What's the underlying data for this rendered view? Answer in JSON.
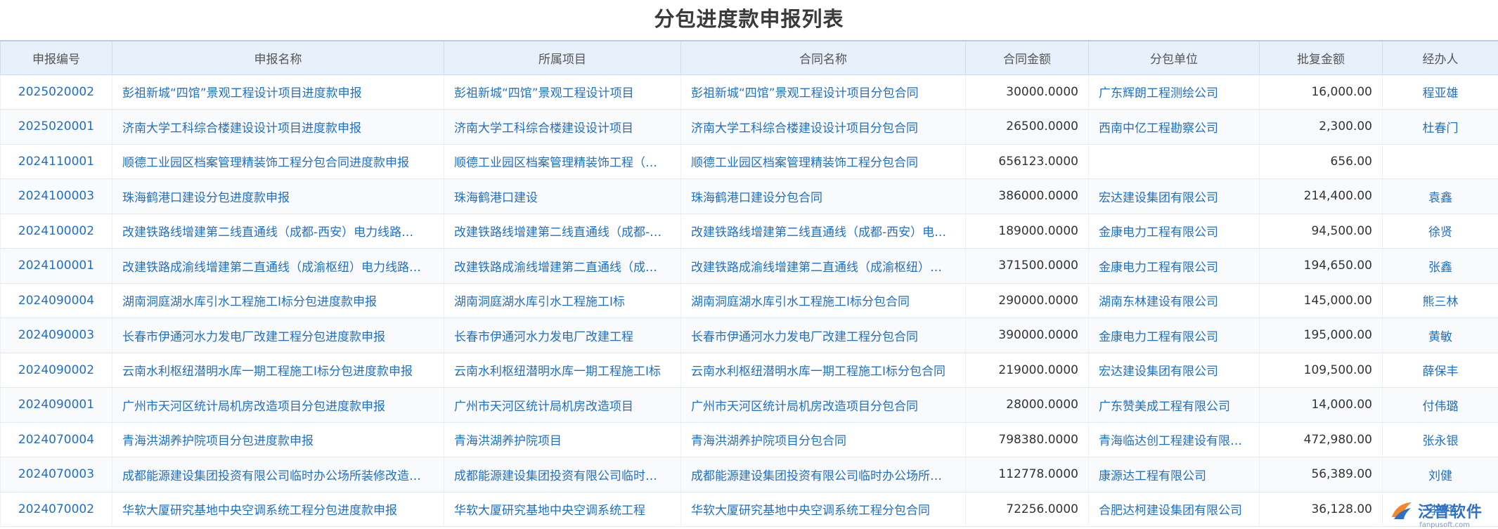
{
  "page": {
    "title": "分包进度款申报列表"
  },
  "table": {
    "columns": [
      "申报编号",
      "申报名称",
      "所属项目",
      "合同名称",
      "合同金额",
      "分包单位",
      "批复金额",
      "经办人"
    ],
    "rows": [
      [
        "2025020002",
        "彭祖新城“四馆”景观工程设计项目进度款申报",
        "彭祖新城“四馆”景观工程设计项目",
        "彭祖新城“四馆”景观工程设计项目分包合同",
        "30000.0000",
        "广东辉朗工程测绘公司",
        "16,000.00",
        "程亚雄"
      ],
      [
        "2025020001",
        "济南大学工科综合楼建设设计项目进度款申报",
        "济南大学工科综合楼建设设计项目",
        "济南大学工科综合楼建设设计项目分包合同",
        "26500.0000",
        "西南中亿工程勘察公司",
        "2,300.00",
        "杜春门"
      ],
      [
        "2024110001",
        "顺德工业园区档案管理精装饰工程分包合同进度款申报",
        "顺德工业园区档案管理精装饰工程（…",
        "顺德工业园区档案管理精装饰工程分包合同",
        "656123.0000",
        "",
        "656.00",
        ""
      ],
      [
        "2024100003",
        "珠海鹤港口建设分包进度款申报",
        "珠海鹤港口建设",
        "珠海鹤港口建设分包合同",
        "386000.0000",
        "宏达建设集团有限公司",
        "214,400.00",
        "袁鑫"
      ],
      [
        "2024100002",
        "改建铁路线增建第二线直通线（成都-西安）电力线路…",
        "改建铁路线增建第二线直通线（成都-…",
        "改建铁路线增建第二线直通线（成都-西安）电…",
        "189000.0000",
        "金康电力工程有限公司",
        "94,500.00",
        "徐贤"
      ],
      [
        "2024100001",
        "改建铁路成渝线增建第二直通线（成渝枢纽）电力线路…",
        "改建铁路成渝线增建第二直通线（成…",
        "改建铁路成渝线增建第二直通线（成渝枢纽）…",
        "371500.0000",
        "金康电力工程有限公司",
        "194,650.00",
        "张鑫"
      ],
      [
        "2024090004",
        "湖南洞庭湖水库引水工程施工I标分包进度款申报",
        "湖南洞庭湖水库引水工程施工I标",
        "湖南洞庭湖水库引水工程施工I标分包合同",
        "290000.0000",
        "湖南东林建设有限公司",
        "145,000.00",
        "熊三林"
      ],
      [
        "2024090003",
        "长春市伊通河水力发电厂改建工程分包进度款申报",
        "长春市伊通河水力发电厂改建工程",
        "长春市伊通河水力发电厂改建工程分包合同",
        "390000.0000",
        "金康电力工程有限公司",
        "195,000.00",
        "黄敏"
      ],
      [
        "2024090002",
        "云南水利枢纽潜明水库一期工程施工I标分包进度款申报",
        "云南水利枢纽潜明水库一期工程施工I标",
        "云南水利枢纽潜明水库一期工程施工I标分包合同",
        "219000.0000",
        "宏达建设集团有限公司",
        "109,500.00",
        "薛保丰"
      ],
      [
        "2024090001",
        "广州市天河区统计局机房改造项目分包进度款申报",
        "广州市天河区统计局机房改造项目",
        "广州市天河区统计局机房改造项目分包合同",
        "28000.0000",
        "广东赞美成工程有限公司",
        "14,000.00",
        "付伟璐"
      ],
      [
        "2024070004",
        "青海洪湖养护院项目分包进度款申报",
        "青海洪湖养护院项目",
        "青海洪湖养护院项目分包合同",
        "798380.0000",
        "青海临达创工程建设有限…",
        "472,980.00",
        "张永银"
      ],
      [
        "2024070003",
        "成都能源建设集团投资有限公司临时办公场所装修改造…",
        "成都能源建设集团投资有限公司临时…",
        "成都能源建设集团投资有限公司临时办公场所…",
        "112778.0000",
        "康源达工程有限公司",
        "56,389.00",
        "刘健"
      ],
      [
        "2024070002",
        "华软大厦研究基地中央空调系统工程分包进度款申报",
        "华软大厦研究基地中央空调系统工程",
        "华软大厦研究基地中央空调系统工程分包合同",
        "72256.0000",
        "合肥达柯建设集团有限公司",
        "36,128.00",
        "李明"
      ]
    ]
  },
  "logo": {
    "name": "泛普软件",
    "url_text": "fanpusoft.com"
  },
  "colors": {
    "link": "#1f6fc5",
    "header_bg": "#e7f0fb"
  }
}
